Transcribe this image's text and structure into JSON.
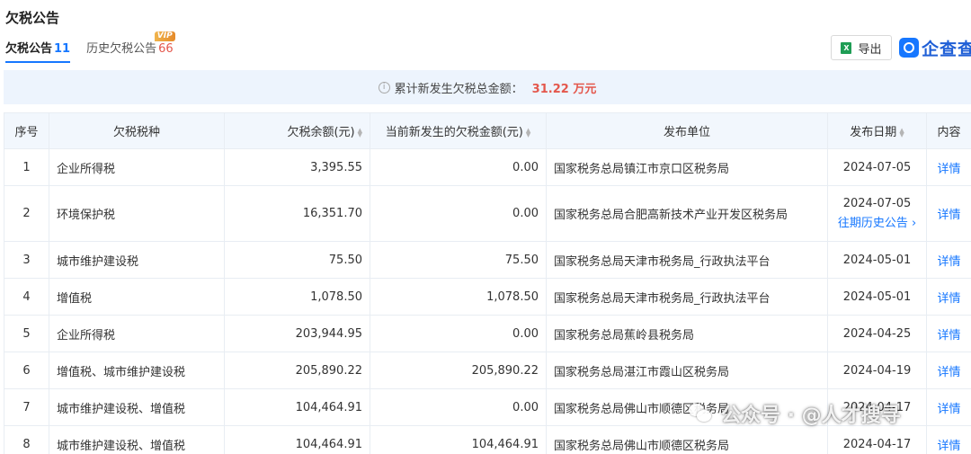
{
  "page": {
    "title": "欠税公告"
  },
  "tabs": [
    {
      "label": "欠税公告",
      "count": "11"
    },
    {
      "label": "历史欠税公告",
      "count": "66",
      "badge": "VIP"
    }
  ],
  "toolbar": {
    "export_label": "导出",
    "export_icon": "excel-icon"
  },
  "brand": {
    "name": "企查查",
    "icon": "qichacha-logo-icon"
  },
  "summary": {
    "label": "累计新发生欠税总金额：",
    "amount": "31.22 万元"
  },
  "table": {
    "columns": [
      "序号",
      "欠税税种",
      "欠税余额(元)",
      "当前新发生的欠税金额(元)",
      "发布单位",
      "发布日期",
      "内容"
    ],
    "rows": [
      {
        "idx": "1",
        "tax_type": "企业所得税",
        "balance": "3,395.55",
        "new_amount": "0.00",
        "publisher": "国家税务总局镇江市京口区税务局",
        "date": "2024-07-05",
        "detail": "详情"
      },
      {
        "idx": "2",
        "tax_type": "环境保护税",
        "balance": "16,351.70",
        "new_amount": "0.00",
        "publisher": "国家税务总局合肥高新技术产业开发区税务局",
        "date": "2024-07-05",
        "history_link": "往期历史公告",
        "detail": "详情"
      },
      {
        "idx": "3",
        "tax_type": "城市维护建设税",
        "balance": "75.50",
        "new_amount": "75.50",
        "publisher": "国家税务总局天津市税务局_行政执法平台",
        "date": "2024-05-01",
        "detail": "详情"
      },
      {
        "idx": "4",
        "tax_type": "增值税",
        "balance": "1,078.50",
        "new_amount": "1,078.50",
        "publisher": "国家税务总局天津市税务局_行政执法平台",
        "date": "2024-05-01",
        "detail": "详情"
      },
      {
        "idx": "5",
        "tax_type": "企业所得税",
        "balance": "203,944.95",
        "new_amount": "0.00",
        "publisher": "国家税务总局蕉岭县税务局",
        "date": "2024-04-25",
        "detail": "详情"
      },
      {
        "idx": "6",
        "tax_type": "增值税、城市维护建设税",
        "balance": "205,890.22",
        "new_amount": "205,890.22",
        "publisher": "国家税务总局湛江市霞山区税务局",
        "date": "2024-04-19",
        "detail": "详情"
      },
      {
        "idx": "7",
        "tax_type": "城市维护建设税、增值税",
        "balance": "104,464.91",
        "new_amount": "0.00",
        "publisher": "国家税务总局佛山市顺德区税务局",
        "date": "2024-04-17",
        "detail": "详情"
      },
      {
        "idx": "8",
        "tax_type": "城市维护建设税、增值税",
        "balance": "104,464.91",
        "new_amount": "104,464.91",
        "publisher": "国家税务总局佛山市顺德区税务局",
        "date": "2024-04-17",
        "detail": "详情"
      }
    ]
  },
  "watermark": {
    "text": "公众号 · @人才搜寻",
    "icon": "wechat-icon"
  },
  "colors": {
    "accent": "#1677ff",
    "highlight": "#e4574c",
    "header_bg": "#f2f7fd",
    "summary_bg": "#edf4fd"
  }
}
